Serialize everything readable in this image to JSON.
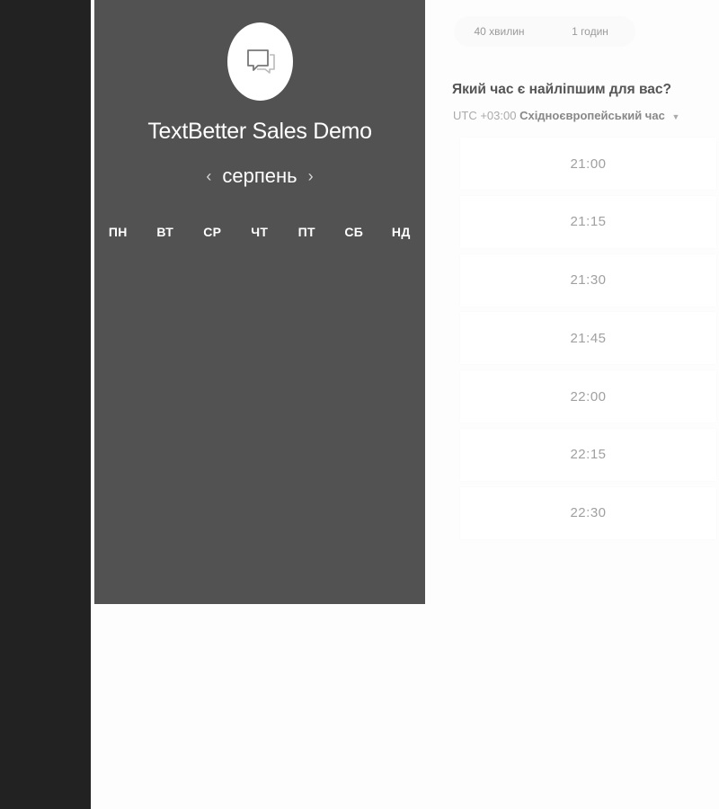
{
  "header": {
    "title": "TextBetter Sales Demo",
    "avatar_icon": "chat-bubbles-icon"
  },
  "calendar": {
    "month": "серпень",
    "prev_icon": "chevron-left-icon",
    "next_icon": "chevron-right-icon",
    "prev_label": "‹",
    "next_label": "›",
    "weekdays": [
      "ПН",
      "ВТ",
      "СР",
      "ЧТ",
      "ПТ",
      "СБ",
      "НД"
    ]
  },
  "durations": [
    "40 хвилин",
    "1 годин"
  ],
  "question": "Який час є найліпшим для вас?",
  "timezone": {
    "offset": "UTC +03:00",
    "name": "Східноєвропейський час",
    "caret": "▼"
  },
  "time_slots": [
    "21:00",
    "21:15",
    "21:30",
    "21:45",
    "22:00",
    "22:15",
    "22:30"
  ],
  "colors": {
    "left_rail": "#222222",
    "calendar_panel": "#525252",
    "background": "#fdfdfd"
  }
}
